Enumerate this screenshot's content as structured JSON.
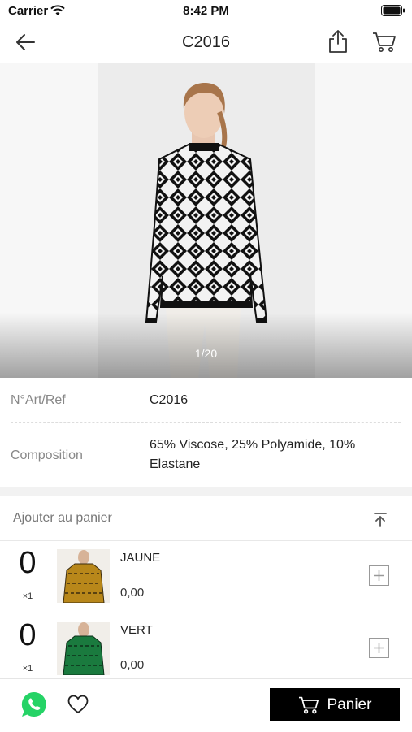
{
  "status_bar": {
    "carrier": "Carrier",
    "time": "8:42 PM"
  },
  "header": {
    "title": "C2016",
    "icons": [
      "back-arrow-icon",
      "share-icon",
      "cart-icon"
    ]
  },
  "gallery": {
    "counter": "1/20"
  },
  "details": {
    "ref_label": "N°Art/Ref",
    "ref_value": "C2016",
    "composition_label": "Composition",
    "composition_line1": "65% Viscose, 25% Polyamide, 10%",
    "composition_line2": "Elastane"
  },
  "add_to_cart": {
    "title": "Ajouter au panier",
    "variants": [
      {
        "qty": "0",
        "multiplier": "×1",
        "color": "JAUNE",
        "price": "0,00",
        "swatch": "#b8871a"
      },
      {
        "qty": "0",
        "multiplier": "×1",
        "color": "VERT",
        "price": "0,00",
        "swatch": "#1a7a3e"
      }
    ]
  },
  "bottom_bar": {
    "cart_button": "Panier",
    "whatsapp_color": "#25d366"
  }
}
